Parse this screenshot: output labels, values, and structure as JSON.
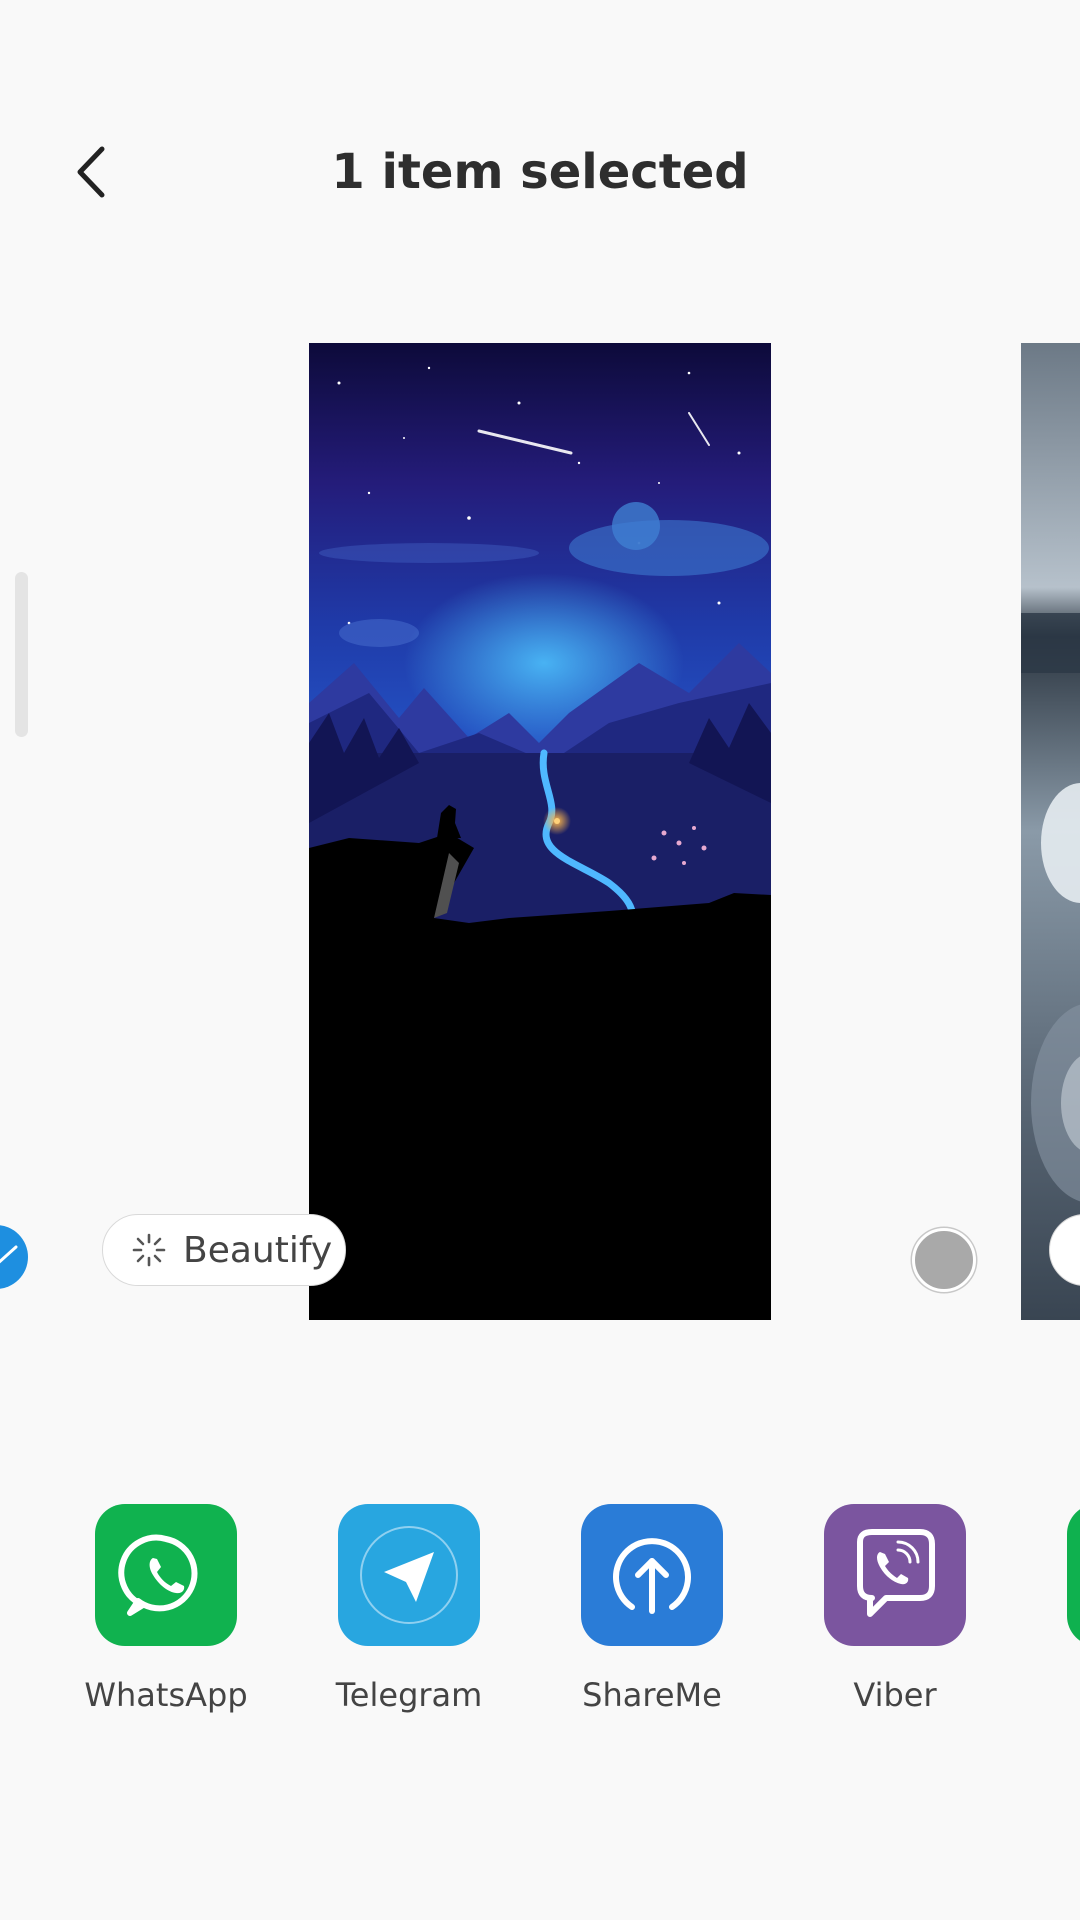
{
  "header": {
    "title": "1 item selected",
    "back_icon": "chevron-left-icon"
  },
  "preview": {
    "beautify_label": "Beautify",
    "beautify_icon": "sparkle-icon",
    "check_color": "#1e8fe0",
    "unselected_color": "#a9a9a9"
  },
  "share": {
    "apps": [
      {
        "label": "WhatsApp",
        "icon": "whatsapp-icon",
        "color": "#10b24f"
      },
      {
        "label": "Telegram",
        "icon": "telegram-icon",
        "color": "#28a6e0"
      },
      {
        "label": "ShareMe",
        "icon": "shareme-icon",
        "color": "#2a7cd7"
      },
      {
        "label": "Viber",
        "icon": "viber-icon",
        "color": "#7b559f"
      }
    ]
  }
}
